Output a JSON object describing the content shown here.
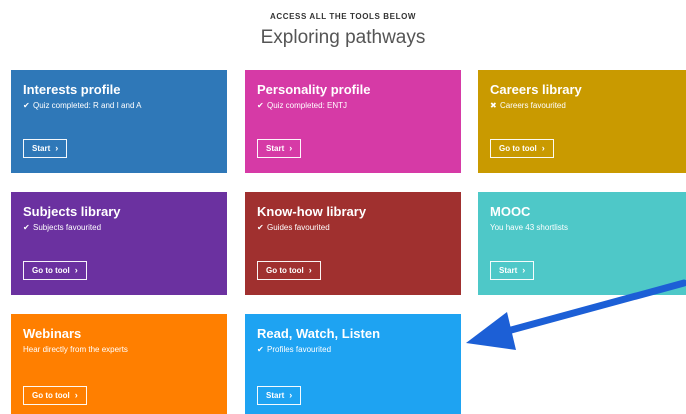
{
  "header": {
    "eyebrow": "ACCESS ALL THE TOOLS BELOW",
    "title": "Exploring pathways"
  },
  "cards": [
    {
      "title": "Interests profile",
      "status": "Quiz completed: R and I and A",
      "status_icon": "check-icon",
      "button_label": "Start",
      "color": "#2f78b8"
    },
    {
      "title": "Personality profile",
      "status": "Quiz completed: ENTJ",
      "status_icon": "check-icon",
      "button_label": "Start",
      "color": "#d63aa6"
    },
    {
      "title": "Careers library",
      "status": "Careers favourited",
      "status_icon": "x-icon",
      "button_label": "Go to tool",
      "color": "#c99a00"
    },
    {
      "title": "Subjects library",
      "status": "Subjects favourited",
      "status_icon": "check-icon",
      "button_label": "Go to tool",
      "color": "#6b31a0"
    },
    {
      "title": "Know-how library",
      "status": "Guides favourited",
      "status_icon": "check-icon",
      "button_label": "Go to tool",
      "color": "#a0302f"
    },
    {
      "title": "MOOC",
      "status": "You have 43 shortlists",
      "status_icon": "",
      "button_label": "Start",
      "color": "#4ec8c8"
    },
    {
      "title": "Webinars",
      "status": "Hear directly from the experts",
      "status_icon": "",
      "button_label": "Go to tool",
      "color": "#ff7f00"
    },
    {
      "title": "Read, Watch, Listen",
      "status": "Profiles favourited",
      "status_icon": "check-icon",
      "button_label": "Start",
      "color": "#1ea3f2"
    }
  ],
  "icons": {
    "check-icon": "✔",
    "x-icon": "✖",
    "chevron-right-icon": "›"
  },
  "annotation": {
    "arrow_color": "#1c5fd6"
  }
}
